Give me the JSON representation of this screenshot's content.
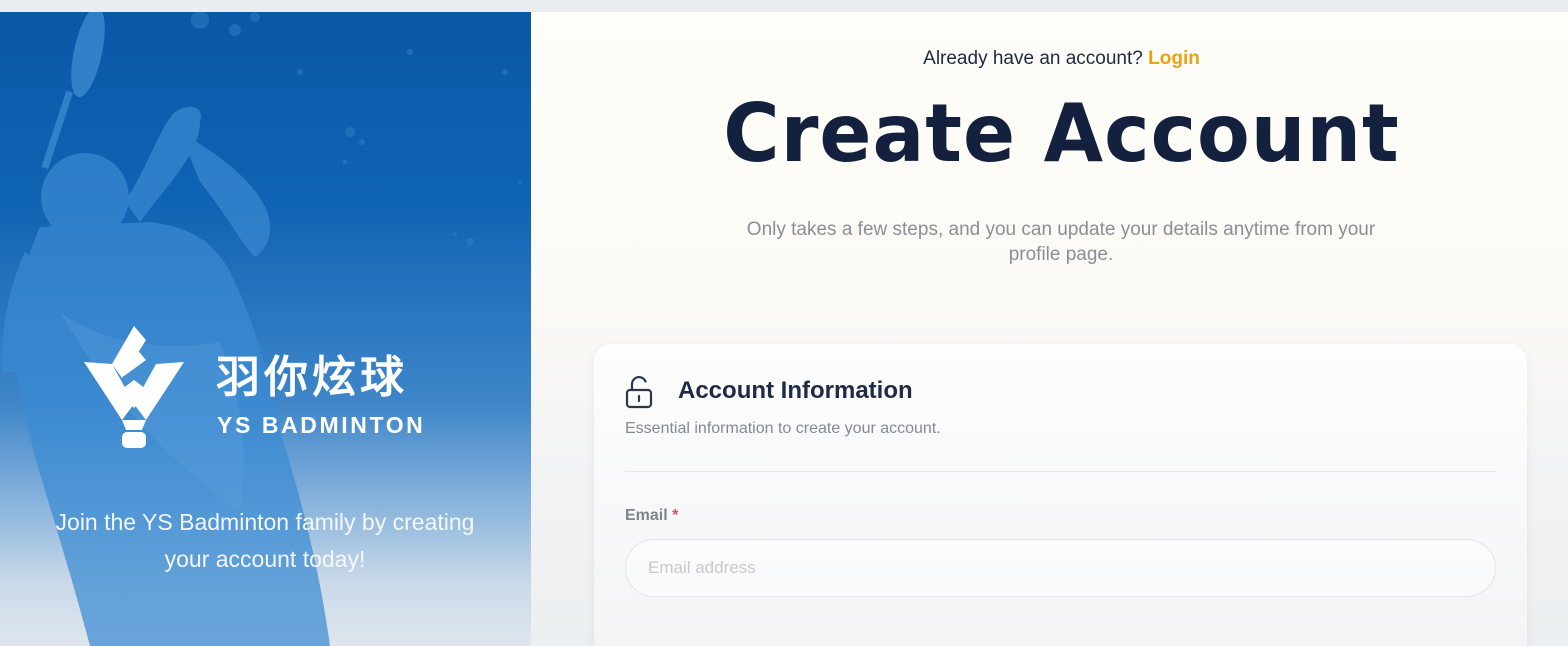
{
  "brand": {
    "name_cn": "羽你炫球",
    "name_en": "YS BADMINTON",
    "tagline": "Join the YS Badminton family by creating your account today!"
  },
  "header": {
    "already_text": "Already have an account?",
    "login_label": "Login",
    "title": "Create Account",
    "subtitle": "Only takes a few steps, and you can update your details anytime from your profile page."
  },
  "account_section": {
    "icon": "lock-icon",
    "title": "Account Information",
    "description": "Essential information to create your account.",
    "email": {
      "label": "Email",
      "required_marker": "*",
      "placeholder": "Email address",
      "value": ""
    }
  },
  "colors": {
    "brand_blue": "#0a58a8",
    "accent_login": "#e9a213",
    "title_navy": "#13213f",
    "required_red": "#e05050"
  }
}
